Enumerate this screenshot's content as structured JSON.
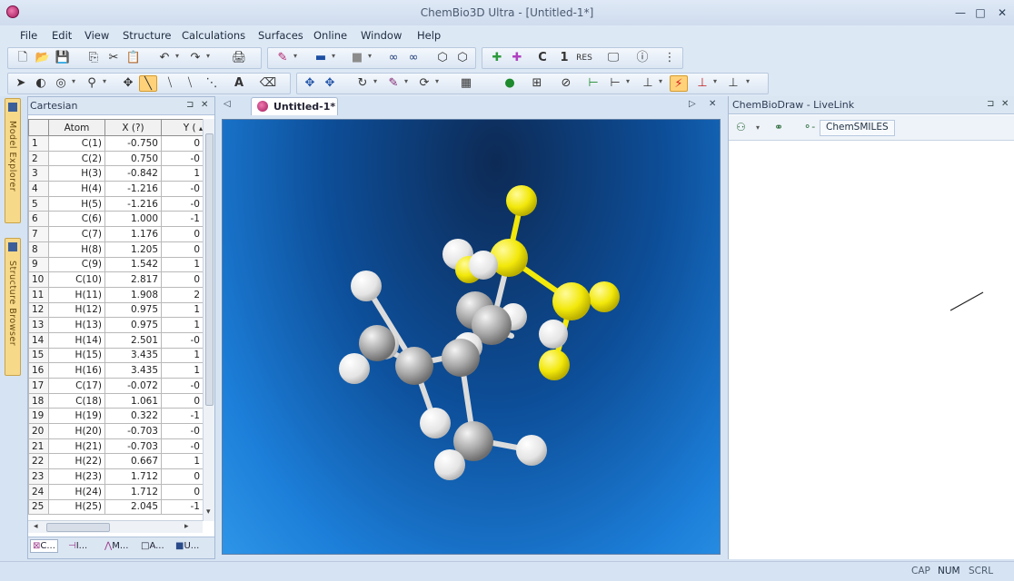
{
  "window": {
    "title": "ChemBio3D Ultra - [Untitled-1*]",
    "controls": [
      "—",
      "□",
      "✕"
    ]
  },
  "menu": [
    "File",
    "Edit",
    "View",
    "Structure",
    "Calculations",
    "Surfaces",
    "Online",
    "Window",
    "Help"
  ],
  "toolbar": {
    "c_label": "C",
    "one_label": "1",
    "res_label": "RES",
    "text_label": "A"
  },
  "left_tabs": {
    "model_explorer": "Model Explorer",
    "structure_browser": "Structure Browser"
  },
  "cartesian": {
    "title": "Cartesian",
    "headers": [
      "",
      "Atom",
      "X (?)",
      "Y ("
    ],
    "rows": [
      [
        "1",
        "C(1)",
        "-0.750",
        "0"
      ],
      [
        "2",
        "C(2)",
        "0.750",
        "-0"
      ],
      [
        "3",
        "H(3)",
        "-0.842",
        "1"
      ],
      [
        "4",
        "H(4)",
        "-1.216",
        "-0"
      ],
      [
        "5",
        "H(5)",
        "-1.216",
        "-0"
      ],
      [
        "6",
        "C(6)",
        "1.000",
        "-1"
      ],
      [
        "7",
        "C(7)",
        "1.176",
        "0"
      ],
      [
        "8",
        "H(8)",
        "1.205",
        "0"
      ],
      [
        "9",
        "C(9)",
        "1.542",
        "1"
      ],
      [
        "10",
        "C(10)",
        "2.817",
        "0"
      ],
      [
        "11",
        "H(11)",
        "1.908",
        "2"
      ],
      [
        "12",
        "H(12)",
        "0.975",
        "1"
      ],
      [
        "13",
        "H(13)",
        "0.975",
        "1"
      ],
      [
        "14",
        "H(14)",
        "2.501",
        "-0"
      ],
      [
        "15",
        "H(15)",
        "3.435",
        "1"
      ],
      [
        "16",
        "H(16)",
        "3.435",
        "1"
      ],
      [
        "17",
        "C(17)",
        "-0.072",
        "-0"
      ],
      [
        "18",
        "C(18)",
        "1.061",
        "0"
      ],
      [
        "19",
        "H(19)",
        "0.322",
        "-1"
      ],
      [
        "20",
        "H(20)",
        "-0.703",
        "-0"
      ],
      [
        "21",
        "H(21)",
        "-0.703",
        "-0"
      ],
      [
        "22",
        "H(22)",
        "0.667",
        "1"
      ],
      [
        "23",
        "H(23)",
        "1.712",
        "0"
      ],
      [
        "24",
        "H(24)",
        "1.712",
        "0"
      ],
      [
        "25",
        "H(25)",
        "2.045",
        "-1"
      ]
    ],
    "bottom_tabs": [
      "C...",
      "I...",
      "M...",
      "A...",
      "U..."
    ]
  },
  "document": {
    "tab_label": "Untitled-1*"
  },
  "livelink": {
    "title": "ChemBioDraw - LiveLink",
    "chemsmiles_label": "ChemSMILES"
  },
  "status": {
    "cap": "CAP",
    "num": "NUM",
    "scrl": "SCRL"
  }
}
